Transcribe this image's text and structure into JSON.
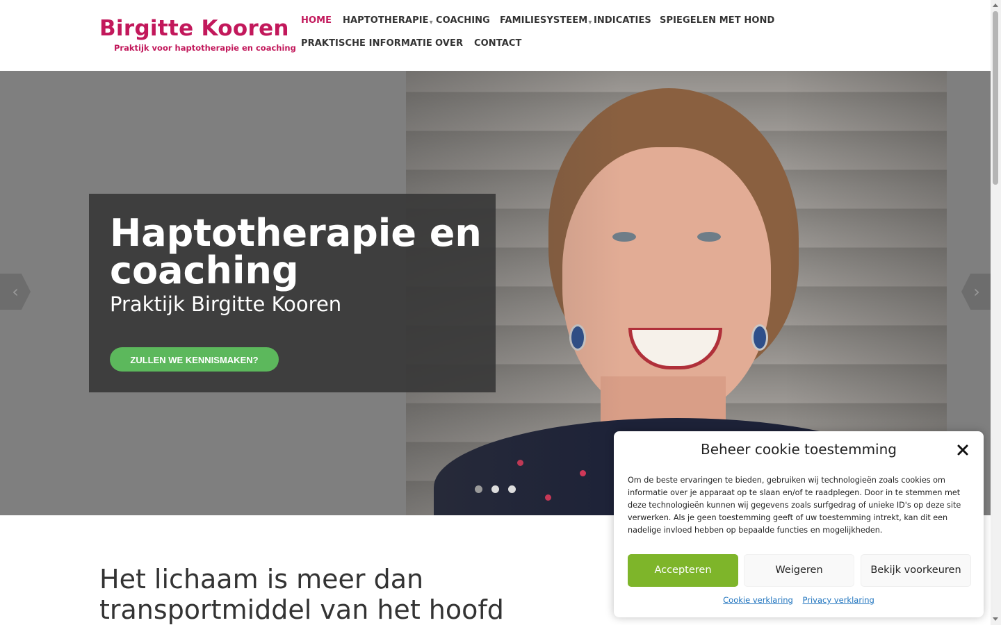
{
  "logo": {
    "name": "Birgitte Kooren",
    "tagline": "Praktijk voor haptotherapie en coaching",
    "color": "#c2185b"
  },
  "nav": {
    "items": [
      {
        "label": "HOME",
        "active": true
      },
      {
        "label": "HAPTOTHERAPIE",
        "dropdown": true
      },
      {
        "label": "COACHING"
      },
      {
        "label": "FAMILIESYSTEEM",
        "dropdown": true
      },
      {
        "label": "INDICATIES"
      },
      {
        "label": "SPIEGELEN MET HOND"
      },
      {
        "label": "PRAKTISCHE INFORMATIE"
      },
      {
        "label": "OVER"
      },
      {
        "label": "CONTACT"
      }
    ],
    "caret": "▾"
  },
  "hero": {
    "title": "Haptotherapie en coaching",
    "subtitle": "Praktijk Birgitte Kooren",
    "cta": "ZULLEN WE KENNISMAKEN?",
    "cta_color": "#5cb85c",
    "prev_icon": "chevron-left-icon",
    "next_icon": "chevron-right-icon",
    "prev_glyph": "‹",
    "next_glyph": "›",
    "active_slide": 1,
    "slide_count": 3
  },
  "content": {
    "heading": "Het lichaam is meer dan transportmiddel van het hoofd"
  },
  "cookie": {
    "title": "Beheer cookie toestemming",
    "text": "Om de beste ervaringen te bieden, gebruiken wij technologieën zoals cookies om informatie over je apparaat op te slaan en/of te raadplegen. Door in te stemmen met deze technologieën kunnen wij gegevens zoals surfgedrag of unieke ID's op deze site verwerken. Als je geen toestemming geeft of uw toestemming intrekt, kan dit een nadelige invloed hebben op bepaalde functies en mogelijkheden.",
    "accept": "Accepteren",
    "deny": "Weigeren",
    "preferences": "Bekijk voorkeuren",
    "cookie_link": "Cookie verklaring",
    "privacy_link": "Privacy verklaring",
    "accept_color": "#7eb52a",
    "close_icon": "close-icon"
  }
}
